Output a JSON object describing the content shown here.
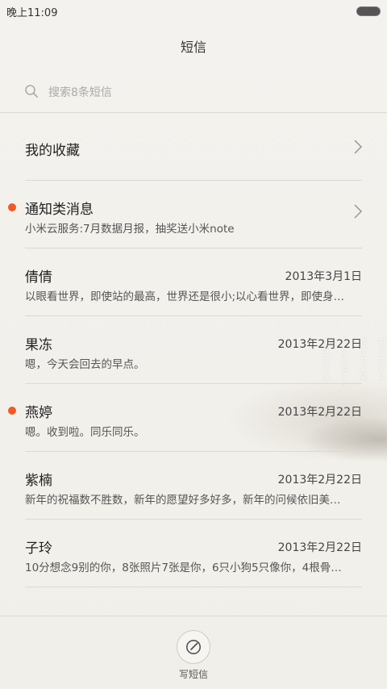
{
  "status_bar": {
    "time": "晚上11:09"
  },
  "header": {
    "title": "短信"
  },
  "search": {
    "placeholder": "搜索8条短信"
  },
  "rows": [
    {
      "name": "我的收藏",
      "preview": "",
      "date": "",
      "unread": false,
      "chevron": true
    },
    {
      "name": "通知类消息",
      "preview": "小米云服务:7月数据月报，抽奖送小米note",
      "date": "",
      "unread": true,
      "chevron": true
    },
    {
      "name": "倩倩",
      "preview": "以眼看世界，即使站的最高，世界还是很小;以心看世界，即使身…",
      "date": "2013年3月1日",
      "unread": false,
      "chevron": false
    },
    {
      "name": "果冻",
      "preview": "嗯，今天会回去的早点。",
      "date": "2013年2月22日",
      "unread": false,
      "chevron": false
    },
    {
      "name": "燕婷",
      "preview": "嗯。收到啦。同乐同乐。",
      "date": "2013年2月22日",
      "unread": true,
      "chevron": false
    },
    {
      "name": "紫楠",
      "preview": "新年的祝福数不胜数，新年的愿望好多好多，新年的问候依旧美…",
      "date": "2013年2月22日",
      "unread": false,
      "chevron": false
    },
    {
      "name": "子玲",
      "preview": "10分想念9别的你，8张照片7张是你，6只小狗5只像你，4根骨…",
      "date": "2013年2月22日",
      "unread": false,
      "chevron": false
    }
  ],
  "bottom_bar": {
    "compose_label": "写短信"
  },
  "colors": {
    "unread_dot": "#f15a24",
    "background": "#f3f1ec"
  }
}
